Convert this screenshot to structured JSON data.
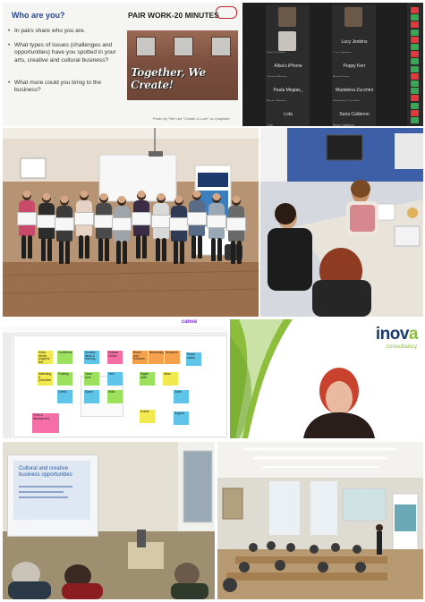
{
  "slide": {
    "question": "Who are you?",
    "heading": "PAIR WORK-20 MINUTES",
    "bullets": [
      "In pairs share who you are.",
      "What types of issues (challenges and opportunities) have you spotted in your arts, creative and cultural business?",
      "What more could you bring to the business?"
    ],
    "photo_text": "Together, We Create!",
    "credit": "Photo by \"We Like \"Create & Love\" on Unsplash"
  },
  "zoom": {
    "participants": [
      {
        "name": "",
        "sub": ""
      },
      {
        "name": "",
        "sub": ""
      },
      {
        "name": "",
        "sub": "Mark Quigley"
      },
      {
        "name": "Lucy Jenkins",
        "sub": "Lucy Jenkins"
      },
      {
        "name": "Ailsa's iPhone",
        "sub": "Ailsa's iPhone"
      },
      {
        "name": "Poppy Kerr",
        "sub": "Poppy Kerr"
      },
      {
        "name": "Paula Megias_",
        "sub": "Paula Megias"
      },
      {
        "name": "Madalena Zucchini",
        "sub": "Madalena Zucchini"
      },
      {
        "name": "Lola",
        "sub": "Lola"
      },
      {
        "name": "Suria Calderon",
        "sub": "Suria Calderon"
      }
    ],
    "side_colors": [
      "#e0393e",
      "#3aa655",
      "#e0393e",
      "#3aa655",
      "#e0393e",
      "#3aa655",
      "#e0393e",
      "#3aa655",
      "#3aa655",
      "#e0393e",
      "#3aa655",
      "#3aa655",
      "#e0393e",
      "#3aa655",
      "#e0393e",
      "#3aa655"
    ]
  },
  "canva": {
    "brand": "canva",
    "notes": [
      {
        "text": "Show clients progress feel creativity",
        "color": "#f2e94e"
      },
      {
        "text": "Confidence",
        "color": "#9be15d"
      },
      {
        "text": "Creative ideas & learning",
        "color": "#5ec4e8"
      },
      {
        "text": "Cultural events",
        "color": "#f56fa6"
      },
      {
        "text": "Brand your business",
        "color": "#f5a04a"
      },
      {
        "text": "Networking",
        "color": "#f5a04a"
      },
      {
        "text": "Research",
        "color": "#f5a04a"
      },
      {
        "text": "Social media",
        "color": "#5ec4e8"
      },
      {
        "text": "Marketing & promotion",
        "color": "#f2e94e"
      },
      {
        "text": "Funding",
        "color": "#9be15d"
      },
      {
        "text": "Team work",
        "color": "#9be15d"
      },
      {
        "text": "Time",
        "color": "#5ec4e8"
      },
      {
        "text": "Digital skills",
        "color": "#9be15d"
      },
      {
        "text": "Ideas",
        "color": "#f2e94e"
      },
      {
        "text": "Clients",
        "color": "#5ec4e8"
      },
      {
        "text": "Space",
        "color": "#5ec4e8"
      },
      {
        "text": "Skills",
        "color": "#9be15d"
      },
      {
        "text": "To do & development",
        "color": "#f56fa6"
      },
      {
        "text": "Events",
        "color": "#f2e94e"
      },
      {
        "text": "Sales",
        "color": "#5ec4e8"
      },
      {
        "text": "Support",
        "color": "#5ec4e8"
      }
    ]
  },
  "inova": {
    "logo_main": "inov",
    "logo_accent": "a",
    "logo_sub": "consultancy"
  },
  "lecture": {
    "screen_text": "Cultural and creative business opportunities"
  }
}
